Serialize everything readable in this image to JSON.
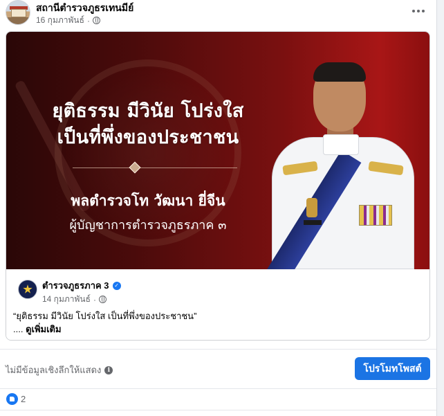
{
  "post": {
    "page_name": "สถานีตำรวจภูธรเทนมีย์",
    "date": "16 กุมภาพันธ์",
    "separator": "·",
    "privacy_icon": "globe-icon",
    "more_icon": "more-options-icon"
  },
  "banner": {
    "headline": "ยุติธรรม มีวินัย โปร่งใส\nเป็นที่พึ่งของประชาชน",
    "officer_name": "พลตำรวจโท วัฒนา ยี่จีน",
    "officer_position": "ผู้บัญชาการตำรวจภูธรภาค ๓"
  },
  "shared": {
    "author": "ตำรวจภูธรภาค 3",
    "verified_icon": "verified-badge-icon",
    "date": "14 กุมภาพันธ์",
    "separator": "·",
    "text": "“ยุติธรรม มีวินัย โปร่งใส เป็นที่พึ่งของประชาชน”",
    "ellipsis": "....",
    "see_more": "ดูเพิ่มเติม"
  },
  "insights": {
    "text": "ไม่มีข้อมูลเชิงลึกให้แสดง",
    "info_icon": "info-icon"
  },
  "actions": {
    "promote_label": "โปรโมทโพสต์"
  },
  "reactions": {
    "icon": "like-icon",
    "count": "2"
  },
  "colors": {
    "accent": "#1b74e4",
    "banner_dark": "#2a0707",
    "banner_red": "#a81616"
  }
}
